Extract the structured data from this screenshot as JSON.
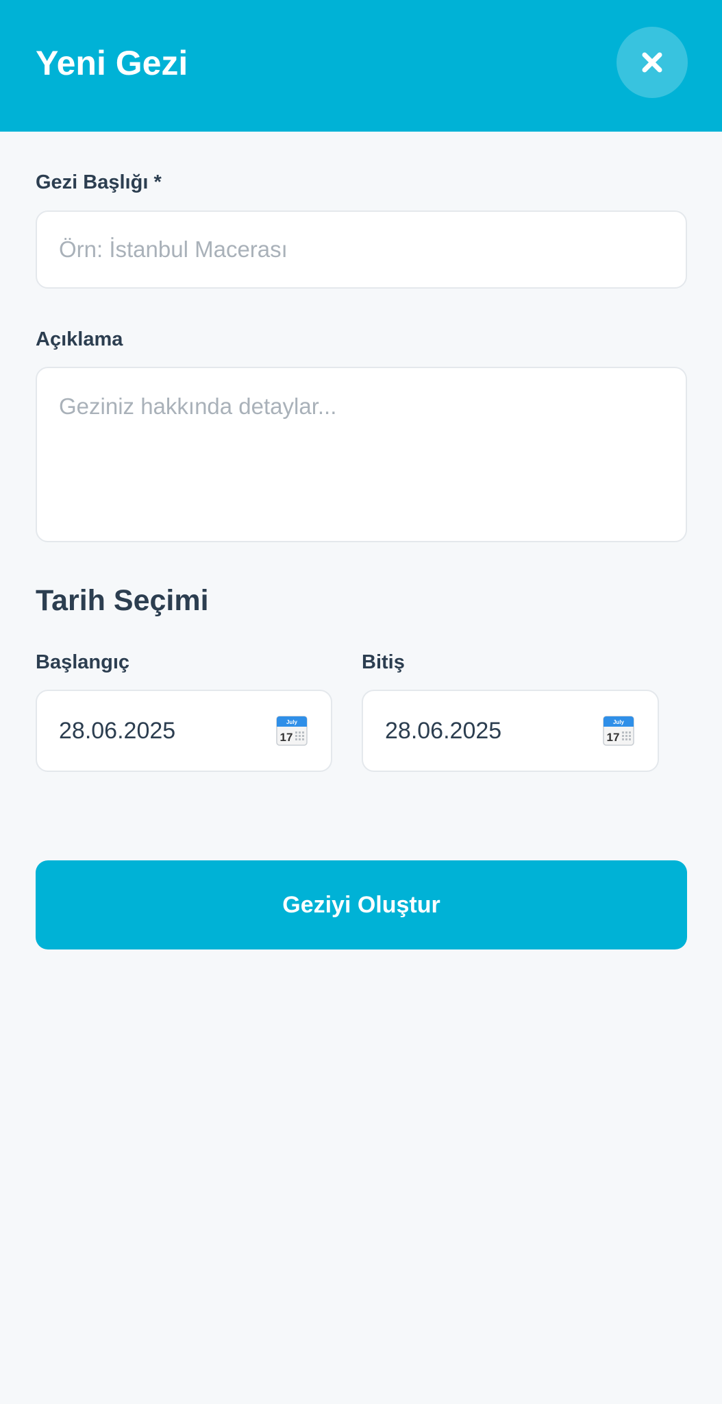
{
  "header": {
    "title": "Yeni Gezi",
    "close_icon": "close-icon"
  },
  "form": {
    "title_field": {
      "label": "Gezi Başlığı *",
      "value": "",
      "placeholder": "Örn: İstanbul Macerası"
    },
    "description_field": {
      "label": "Açıklama",
      "value": "",
      "placeholder": "Geziniz hakkında detaylar..."
    },
    "date_section": {
      "title": "Tarih Seçimi",
      "start": {
        "label": "Başlangıç",
        "value": "28.06.2025",
        "icon": "calendar-icon",
        "icon_month": "July",
        "icon_day": "17"
      },
      "end": {
        "label": "Bitiş",
        "value": "28.06.2025",
        "icon": "calendar-icon",
        "icon_month": "July",
        "icon_day": "17"
      }
    },
    "submit_label": "Geziyi Oluştur"
  },
  "colors": {
    "accent": "#00b2d6",
    "background": "#f6f8fa",
    "text": "#2c3e50",
    "placeholder": "#a9b1b9",
    "border": "#e4e8ec"
  }
}
